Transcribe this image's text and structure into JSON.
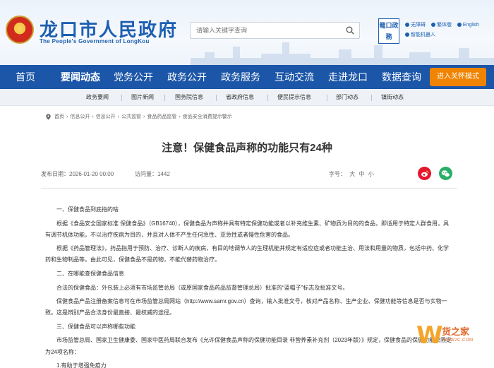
{
  "header": {
    "site_title": "龙口市人民政府",
    "site_subtitle": "The People's Government of LongKou",
    "search_placeholder": "请输入关键字查询",
    "seal_text": "龍口政務",
    "utils": [
      "无障碍",
      "繁体版",
      "English",
      "智能机器人"
    ]
  },
  "nav": {
    "items": [
      "首页",
      "要闻动态",
      "党务公开",
      "政务公开",
      "政务服务",
      "互动交流",
      "走进龙口",
      "数据查询"
    ],
    "active_index": 1,
    "care_mode": "进入关怀模式"
  },
  "subnav": {
    "items": [
      "政务要闻",
      "图片新闻",
      "国务院信息",
      "省政府信息",
      "便民提示信息",
      "部门动态",
      "镇街动态"
    ]
  },
  "breadcrumb": [
    "首页",
    "信息公开",
    "信息公开",
    "公共监管",
    "食品药品监管",
    "食品安全消费提示警示"
  ],
  "article": {
    "title": "注意！保健食品声称的功能只有24种",
    "date_label": "发布日期：",
    "date": "2026-01-20 00:00",
    "visits_label": "访问量：",
    "visits": "1442",
    "font_label": "字号：",
    "font_sizes": [
      "大",
      "中",
      "小"
    ],
    "paragraphs": [
      "一、保健食品到底指的啥",
      "根据《食品安全国家标准 保健食品》（GB16740），保健食品为声称并具有特定保健功能或者以补充维生素、矿物质为目的的食品，即适用于特定人群食用，具有调节机体功能，不以治疗疾病为目的，并且对人体不产生任何急性、亚急性或者慢性危害的食品。",
      "根据《药品管理法》，药品指用于预防、治疗、诊断人的疾病，有目的地调节人的生理机能并规定有适应症或者功能主治、用法和用量的物质，包括中药、化学药和生物制品等。由此可见，保健食品不是药物，不能代替药物治疗。",
      "二、在哪能查保健食品信息",
      "合法的保健食品：外包装上必须有市场监管总局（或原国家食品药品监督管理总局）批准的“蓝帽子”标志及批准文号。",
      "保健食品产品注册备案信息可在市场监管总局网站（http://www.samr.gov.cn）查询，输入批准文号，核对产品名称、生产企业、保健功能等信息是否与实物一致。这是辨别产品合法身份最直接、最权威的途径。",
      "三、保健食品可以声称哪些功能",
      "市场监管总局、国家卫生健康委、国家中医药局联合发布《允许保健食品声称的保健功能目录 非营养素补充剂（2023年版）》规定，保健食品的保健功能只限定为24项名称：",
      "1.有助于增强免疫力"
    ]
  },
  "watermark": {
    "letter": "W",
    "text": "货之家",
    "url": "W1W2C.COM"
  },
  "colors": {
    "brand": "#1b56a8",
    "care": "#f08300",
    "weibo": "#e6162d",
    "wechat": "#2aae67"
  }
}
